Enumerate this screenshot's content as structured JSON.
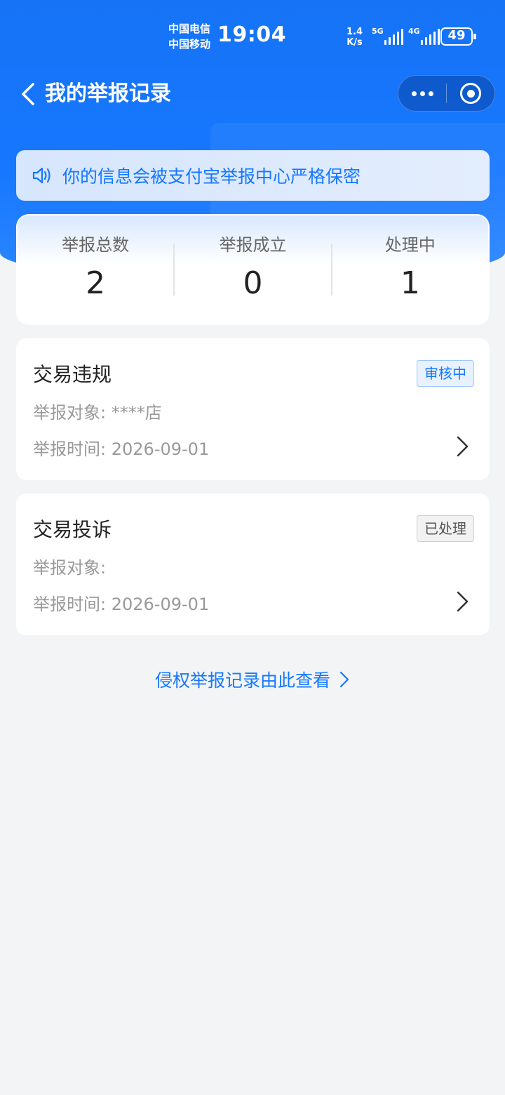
{
  "status_bar": {
    "carrier1": "中国电信",
    "carrier2": "中国移动",
    "time": "19:04",
    "speed_value": "1.4",
    "speed_unit": "K/s",
    "sig1_label": "5G",
    "sig2_label": "4G",
    "battery": "49"
  },
  "nav": {
    "title": "我的举报记录"
  },
  "notice": {
    "text": "你的信息会被支付宝举报中心严格保密"
  },
  "stats": [
    {
      "label": "举报总数",
      "value": "2"
    },
    {
      "label": "举报成立",
      "value": "0"
    },
    {
      "label": "处理中",
      "value": "1"
    }
  ],
  "records": [
    {
      "title": "交易违规",
      "status": "审核中",
      "target_label": "举报对象:",
      "target_value": "****店",
      "time_label": "举报时间:",
      "time_value": "2026-09-01"
    },
    {
      "title": "交易投诉",
      "status": "已处理",
      "target_label": "举报对象:",
      "target_value": "",
      "time_label": "举报时间:",
      "time_value": "2026-09-01"
    }
  ],
  "footer": {
    "link_text": "侵权举报记录由此查看"
  },
  "colors": {
    "primary": "#1677ff",
    "background": "#f3f4f6"
  }
}
